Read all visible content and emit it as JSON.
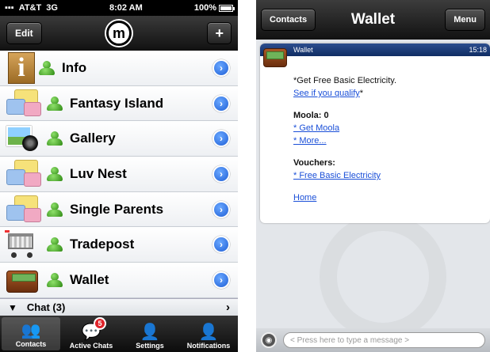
{
  "left": {
    "status": {
      "carrier": "AT&T",
      "network": "3G",
      "time": "8:02 AM",
      "battery": "100%",
      "battery_level": 1.0
    },
    "navbar": {
      "edit_label": "Edit",
      "add_label": "+",
      "logo_letter": "m"
    },
    "items": [
      {
        "label": "Info",
        "icon": "info-icon"
      },
      {
        "label": "Fantasy Island",
        "icon": "chat-bubbles-icon"
      },
      {
        "label": "Gallery",
        "icon": "gallery-icon"
      },
      {
        "label": "Luv Nest",
        "icon": "chat-bubbles-icon"
      },
      {
        "label": "Single Parents",
        "icon": "chat-bubbles-icon"
      },
      {
        "label": "Tradepost",
        "icon": "shopping-cart-icon"
      },
      {
        "label": "Wallet",
        "icon": "wallet-icon"
      }
    ],
    "chat_section": {
      "label": "Chat (3)"
    },
    "tabs": [
      {
        "label": "Contacts",
        "icon": "contacts-icon",
        "active": true
      },
      {
        "label": "Active Chats",
        "icon": "speech-bubble-icon",
        "badge": "5"
      },
      {
        "label": "Settings",
        "icon": "person-icon"
      },
      {
        "label": "Notifications",
        "icon": "notifications-icon"
      }
    ]
  },
  "right": {
    "navbar": {
      "back_label": "Contacts",
      "title": "Wallet",
      "menu_label": "Menu"
    },
    "message": {
      "sender": "Wallet",
      "time": "15:18",
      "intro": "*Get Free Basic Electricity.",
      "qualify_link": "See if you qualify",
      "qualify_suffix": "*",
      "moola_label": "Moola: 0",
      "get_moola_link": "* Get Moola",
      "more_link": "* More...",
      "vouchers_label": "Vouchers:",
      "voucher_link": "* Free Basic Electricity",
      "home_link": "Home"
    },
    "input": {
      "placeholder": "< Press here to type a message >"
    }
  }
}
